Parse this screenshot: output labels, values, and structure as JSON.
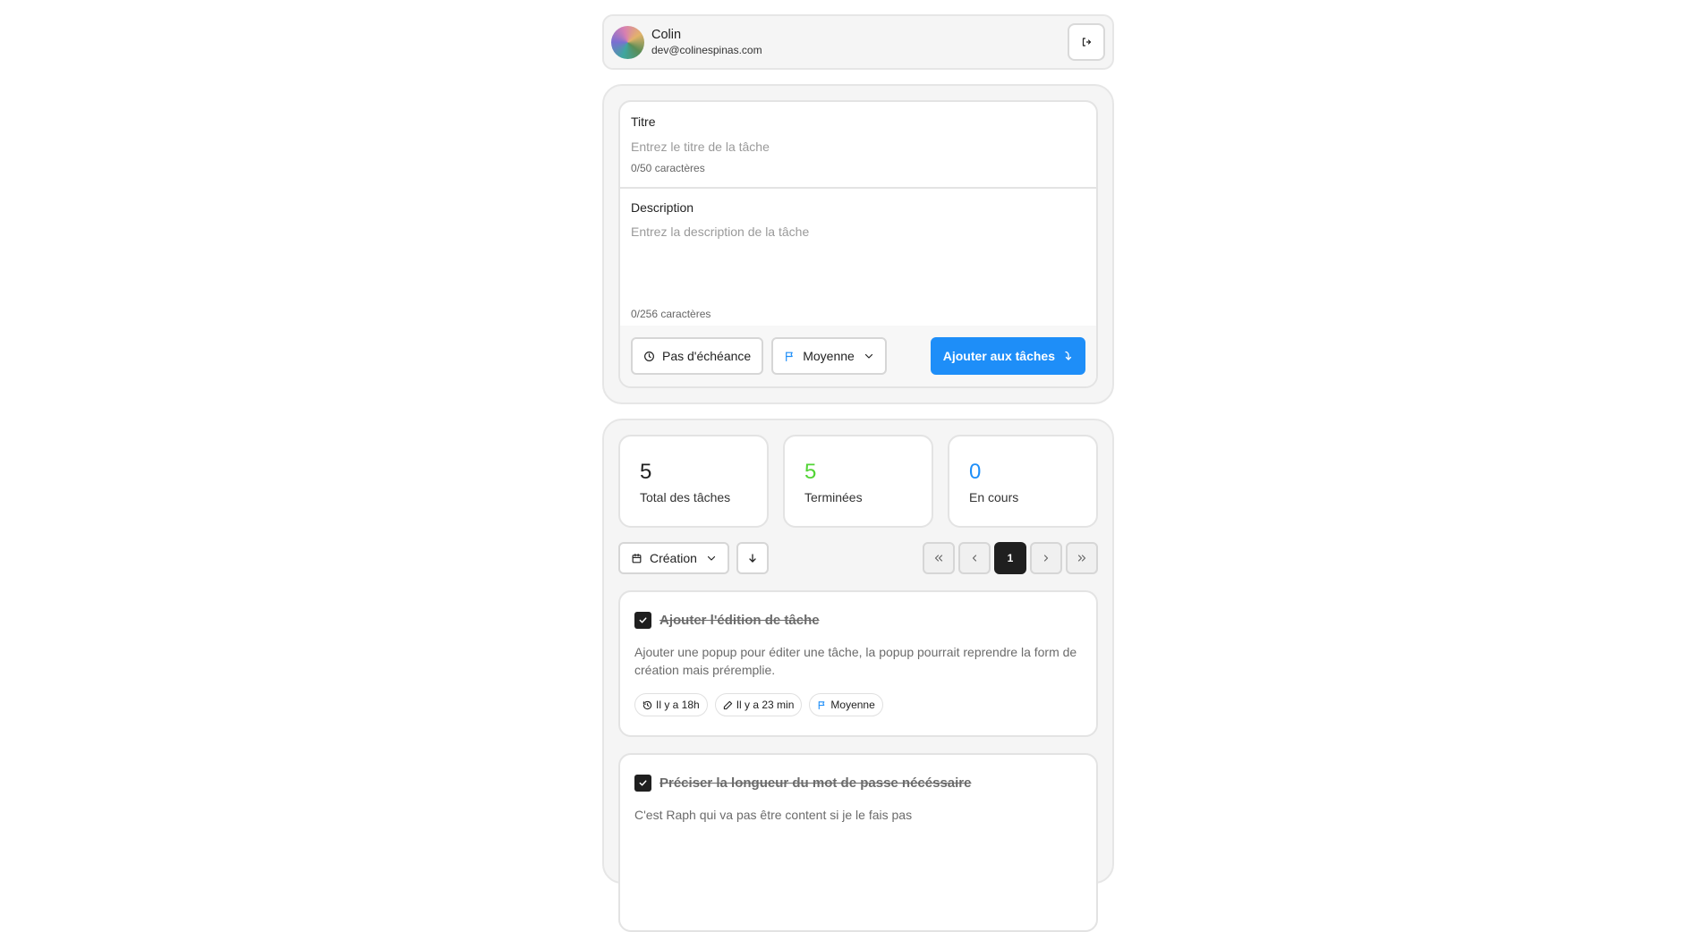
{
  "user": {
    "name": "Colin",
    "email": "dev@colinespinas.com",
    "logout_icon": "logout-icon"
  },
  "form": {
    "title_label": "Titre",
    "title_placeholder": "Entrez le titre de la tâche",
    "title_value": "",
    "title_counter": "0/50 caractères",
    "description_label": "Description",
    "description_placeholder": "Entrez la description de la tâche",
    "description_value": "",
    "description_counter": "0/256 caractères",
    "due_button_label": "Pas d'échéance",
    "priority_select_label": "Moyenne",
    "submit_label": "Ajouter aux tâches",
    "accent_color": "#1e8ef8"
  },
  "stats": [
    {
      "value": "5",
      "label": "Total des tâches",
      "color": "#1f1f1f"
    },
    {
      "value": "5",
      "label": "Terminées",
      "color": "#52d435"
    },
    {
      "value": "0",
      "label": "En cours",
      "color": "#1e8ef8"
    }
  ],
  "toolbar": {
    "sort_label": "Création",
    "current_page": "1"
  },
  "tasks": [
    {
      "title": "Ajouter l'édition de tâche",
      "description": "Ajouter une popup pour éditer une tâche, la popup pourrait reprendre la form de création mais préremplie.",
      "completed": true,
      "chips": [
        {
          "icon": "history-icon",
          "label": "Il y a 18h"
        },
        {
          "icon": "pencil-icon",
          "label": "Il y a 23 min"
        },
        {
          "icon": "flag-icon",
          "label": "Moyenne"
        }
      ]
    },
    {
      "title": "Préciser la longueur du mot de passe nécéssaire",
      "description": "C'est Raph qui va pas être content si je le fais pas",
      "completed": true
    }
  ]
}
